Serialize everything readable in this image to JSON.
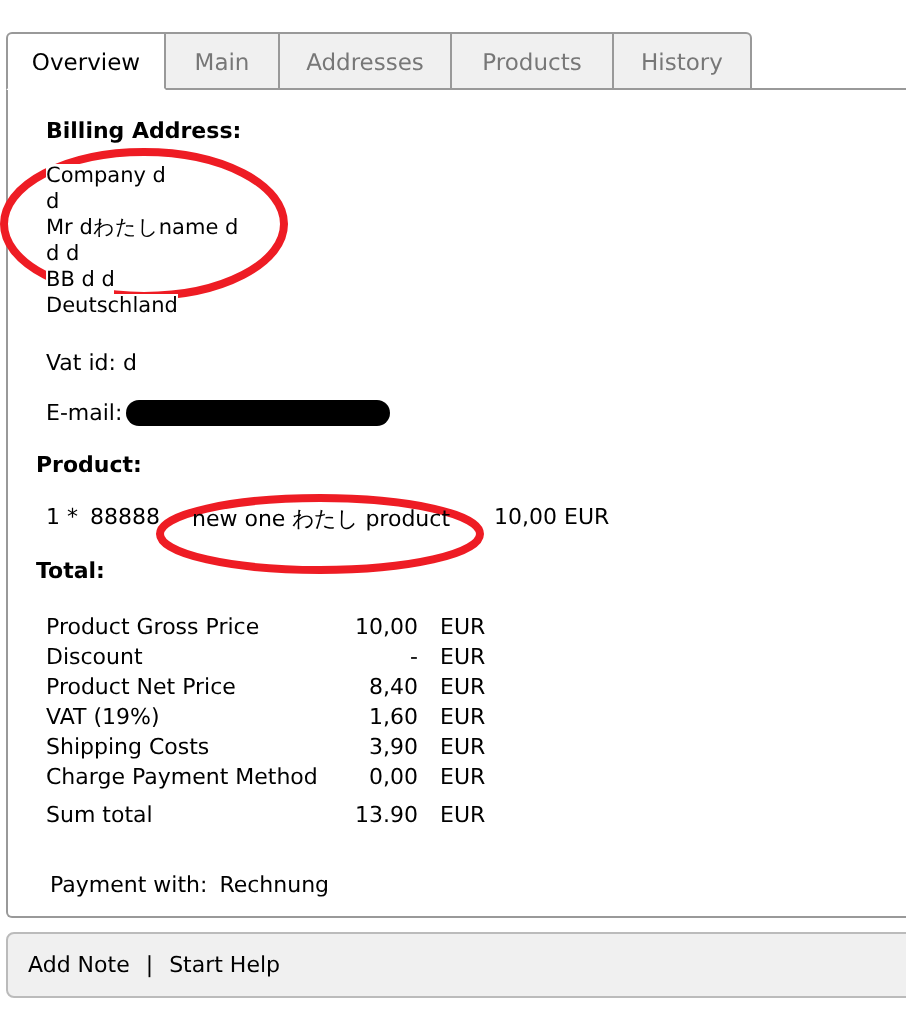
{
  "tabs": [
    {
      "label": "Overview",
      "selected": true
    },
    {
      "label": "Main",
      "selected": false
    },
    {
      "label": "Addresses",
      "selected": false
    },
    {
      "label": "Products",
      "selected": false
    },
    {
      "label": "History",
      "selected": false
    }
  ],
  "billing_address": {
    "heading": "Billing Address:",
    "lines": [
      "Company d",
      "d",
      "Mr dわたしname d",
      "d d",
      "BB d d",
      "Deutschland"
    ],
    "vat_id": "Vat id: d",
    "email_label": "E-mail:"
  },
  "product": {
    "heading": "Product:",
    "items": [
      {
        "quantity": "1 *",
        "number": "88888",
        "name": "new one わたし product",
        "price": "10,00 EUR"
      }
    ]
  },
  "total": {
    "heading": "Total:",
    "rows": [
      {
        "label": "Product Gross Price",
        "amount": "10,00",
        "currency": "EUR"
      },
      {
        "label": "Discount",
        "amount": "-",
        "currency": "EUR"
      },
      {
        "label": "Product Net Price",
        "amount": "8,40",
        "currency": "EUR"
      },
      {
        "label": "VAT (19%)",
        "amount": "1,60",
        "currency": "EUR"
      },
      {
        "label": "Shipping Costs",
        "amount": "3,90",
        "currency": "EUR"
      },
      {
        "label": "Charge Payment Method",
        "amount": "0,00",
        "currency": "EUR"
      }
    ],
    "sum": {
      "label": "Sum total",
      "amount": "13.90",
      "currency": "EUR"
    }
  },
  "payment": {
    "label": "Payment with:",
    "value": "Rechnung"
  },
  "footer_links": [
    "Add Note",
    "Start Help"
  ],
  "footer_separator": "|"
}
